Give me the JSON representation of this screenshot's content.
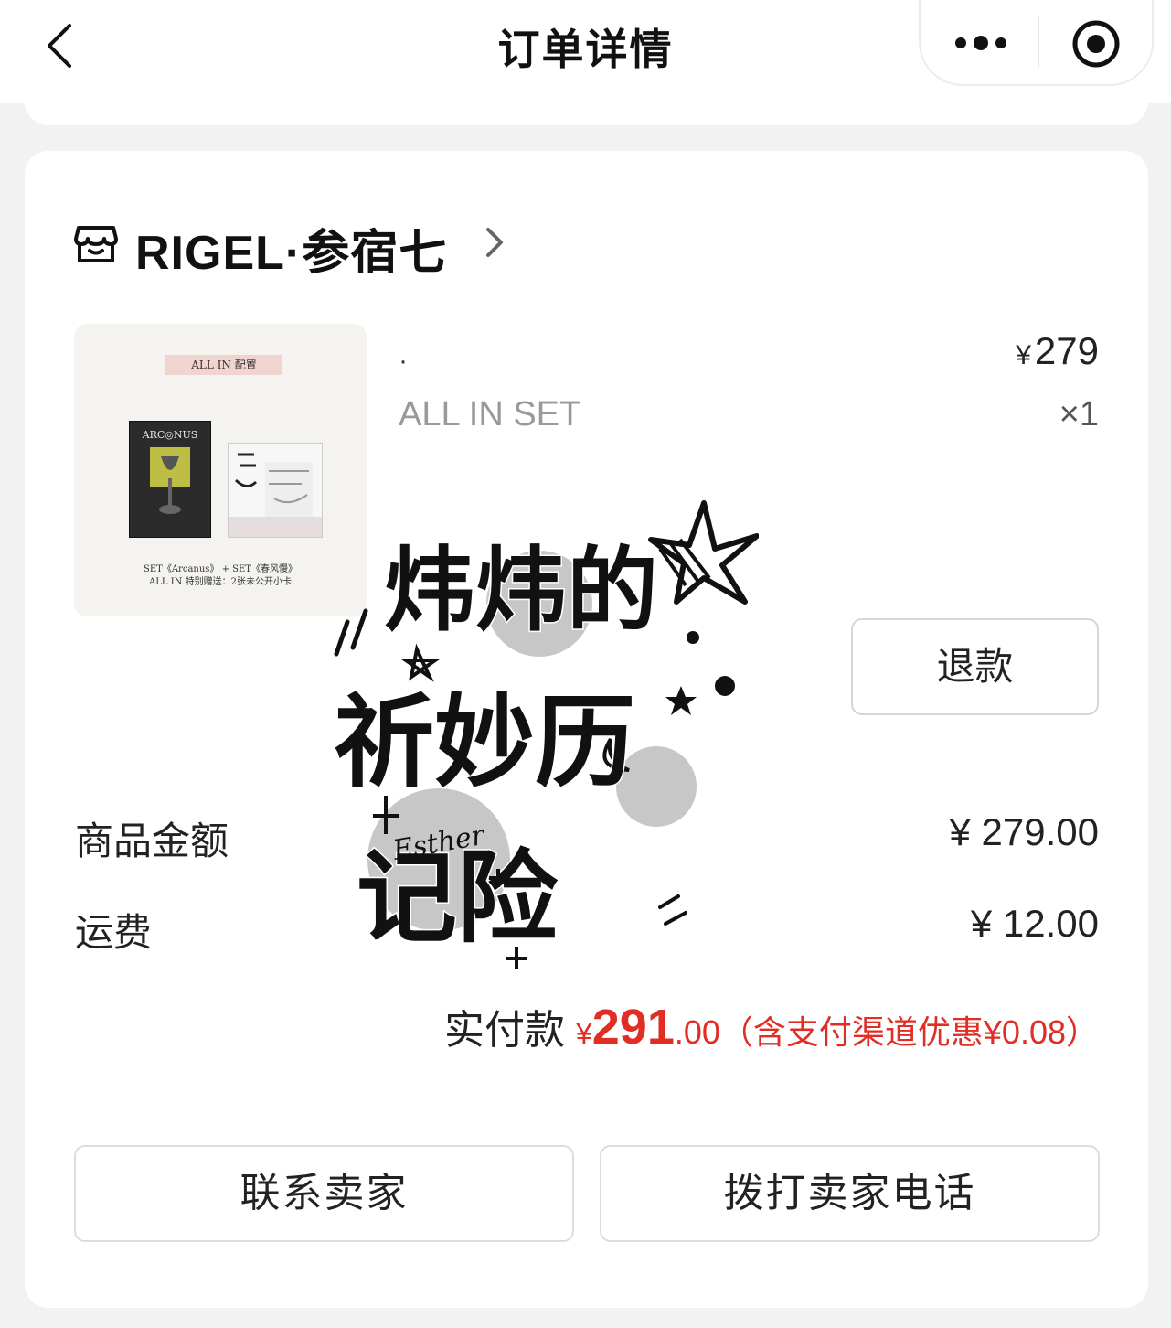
{
  "header": {
    "title": "订单详情"
  },
  "icons": {
    "back": "back-chevron-icon",
    "more": "more-dots-icon",
    "close": "target-circle-icon",
    "shop": "shop-icon",
    "shop_arrow": "chevron-right-icon"
  },
  "shop": {
    "name": "RIGEL·参宿七"
  },
  "product": {
    "title": "·",
    "sku": "ALL IN SET",
    "currency": "¥",
    "price": "279",
    "qty": "×1",
    "image_text": {
      "badge": "ALL IN 配置",
      "album_title": "ARC◎NUS",
      "caption_line1": "SET《Arcanus》 + SET《春风慢》",
      "caption_line2": "ALL IN 特别赠送：2张未公开小卡"
    }
  },
  "actions": {
    "refund": "退款",
    "contact_seller": "联系卖家",
    "call_seller": "拨打卖家电话"
  },
  "summary": {
    "goods_label": "商品金额",
    "goods_value": "¥ 279.00",
    "shipping_label": "运费",
    "shipping_value": "¥ 12.00",
    "paid_label": "实付款",
    "paid_currency": "¥",
    "paid_integer": "291",
    "paid_decimal": ".00",
    "paid_discount": "（含支付渠道优惠¥0.08）"
  },
  "watermark": {
    "line1": "炜炜的",
    "line2": "祈妙历",
    "line3": "记险",
    "signature": "Esther"
  },
  "colors": {
    "accent_red": "#e02e24",
    "background": "#f2f2f2",
    "card": "#ffffff"
  }
}
